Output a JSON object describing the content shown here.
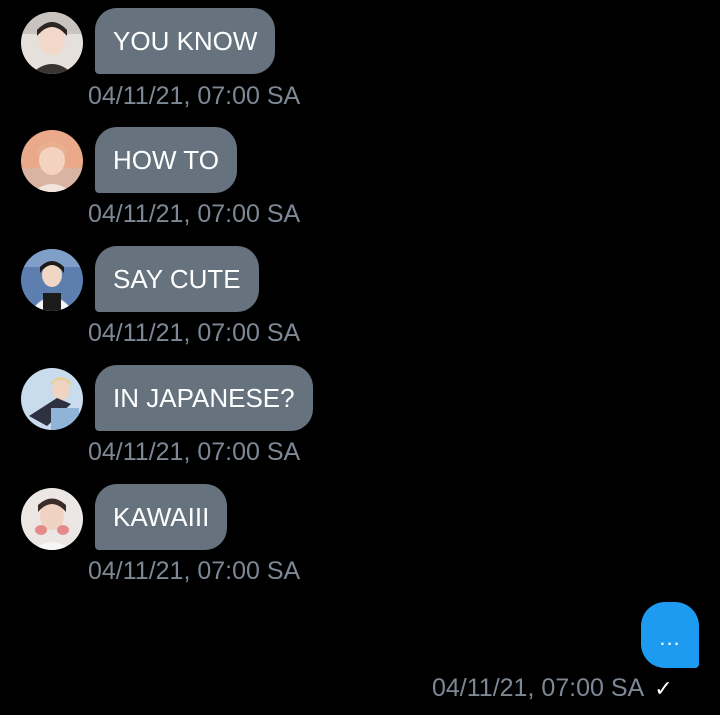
{
  "colors": {
    "background": "#000000",
    "incoming_bubble": "#66737f",
    "outgoing_bubble": "#1d9bf0",
    "timestamp": "#7d8894"
  },
  "messages": [
    {
      "text": "YOU KNOW",
      "time": "04/11/21, 07:00 SA",
      "avatar_icon": "profile-photo-icon"
    },
    {
      "text": "HOW TO",
      "time": "04/11/21, 07:00 SA",
      "avatar_icon": "profile-photo-icon"
    },
    {
      "text": "SAY CUTE",
      "time": "04/11/21, 07:00 SA",
      "avatar_icon": "profile-photo-icon"
    },
    {
      "text": "IN JAPANESE?",
      "time": "04/11/21, 07:00 SA",
      "avatar_icon": "profile-photo-icon"
    },
    {
      "text": "KAWAIII",
      "time": "04/11/21, 07:00 SA",
      "avatar_icon": "profile-photo-icon"
    }
  ],
  "outgoing": {
    "text": "...",
    "time": "04/11/21, 07:00 SA",
    "status_icon": "checkmark-icon",
    "status_glyph": "✓"
  }
}
